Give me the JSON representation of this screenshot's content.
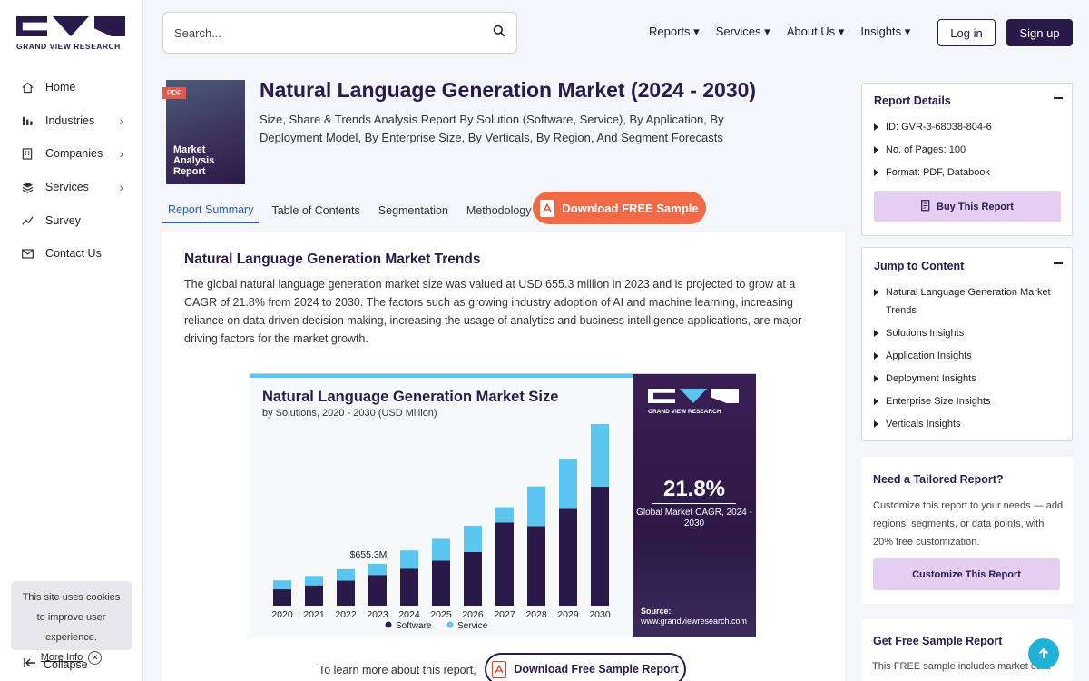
{
  "brand": {
    "name": "GRAND VIEW RESEARCH",
    "colors": {
      "primary": "#2a1a4a",
      "accent": "#5bc6ef",
      "cta": "#f26a45",
      "light_accent": "#e4cff3"
    }
  },
  "sidebar": {
    "items": [
      {
        "label": "Home",
        "icon": "home-icon",
        "has_submenu": false
      },
      {
        "label": "Industries",
        "icon": "bar-chart-icon",
        "has_submenu": true
      },
      {
        "label": "Companies",
        "icon": "building-icon",
        "has_submenu": true
      },
      {
        "label": "Services",
        "icon": "layers-icon",
        "has_submenu": true
      },
      {
        "label": "Survey",
        "icon": "trend-icon",
        "has_submenu": false
      },
      {
        "label": "Contact Us",
        "icon": "mail-icon",
        "has_submenu": false
      }
    ],
    "cookie_text": "This site uses cookies to improve user experience.",
    "cookie_more": "More Info",
    "collapse_label": "Collapse"
  },
  "header": {
    "search_placeholder": "Search...",
    "nav": [
      "Reports",
      "Services",
      "About Us",
      "Insights"
    ],
    "login": "Log in",
    "signup": "Sign up"
  },
  "report": {
    "cover_badge": "PDF",
    "cover_text": "Market Analysis Report",
    "title": "Natural Language Generation Market (2024 - 2030)",
    "subtitle": "Size, Share & Trends Analysis Report By Solution (Software, Service), By Application, By Deployment Model, By Enterprise Size, By Verticals, By Region, And Segment Forecasts",
    "tabs": [
      "Report Summary",
      "Table of Contents",
      "Segmentation",
      "Methodology"
    ],
    "active_tab": "Report Summary",
    "download_btn": "Download FREE Sample"
  },
  "main": {
    "trends_heading": "Natural Language Generation Market Trends",
    "trends_text": "The global natural language generation market size was valued at USD 655.3 million in 2023 and is projected to grow at a CAGR of 21.8% from 2024 to 2030. The factors such as growing industry adoption of AI and machine learning, increasing reliance on data driven decision making, increasing the usage of analytics and business intelligence applications, are major driving factors for the market growth.",
    "learn_more": "To learn more about this report,",
    "download_sample": "Download Free Sample Report"
  },
  "infographic": {
    "title": "Natural Language Generation Market Size",
    "subtitle": "by Solutions, 2020 - 2030 (USD Million)",
    "brand_name": "GRAND VIEW RESEARCH",
    "cagr": "21.8%",
    "cagr_label": "Global Market CAGR, 2024 - 2030",
    "source_label": "Source:",
    "source_url": "www.grandviewresearch.com"
  },
  "chart_data": {
    "type": "bar",
    "stacked": true,
    "title": "Natural Language Generation Market Size",
    "subtitle": "by Solutions, 2020 - 2030 (USD Million)",
    "categories": [
      "2020",
      "2021",
      "2022",
      "2023",
      "2024",
      "2025",
      "2026",
      "2027",
      "2028",
      "2029",
      "2030"
    ],
    "series": [
      {
        "name": "Software",
        "color": "#2a1a4a",
        "values": [
          255,
          317,
          390,
          480,
          578,
          705,
          840,
          1300,
          1245,
          1515,
          1860
        ]
      },
      {
        "name": "Service",
        "color": "#5bc6ef",
        "values": [
          140,
          148,
          180,
          175,
          285,
          340,
          410,
          240,
          620,
          780,
          980
        ]
      }
    ],
    "annotations": [
      {
        "category": "2023",
        "label": "$655.3M"
      }
    ],
    "legend_position": "bottom",
    "grid": false
  },
  "right": {
    "details_heading": "Report Details",
    "details": [
      "ID: GVR-3-68038-804-6",
      "No. of Pages: 100",
      "Format: PDF, Databook"
    ],
    "buy_btn": "Buy This Report",
    "jump_heading": "Jump to Content",
    "jump_items": [
      "Natural Language Generation Market Trends",
      "Solutions Insights",
      "Application Insights",
      "Deployment Insights",
      "Enterprise Size Insights",
      "Verticals Insights"
    ],
    "tailored_heading": "Need a Tailored Report?",
    "tailored_text": "Customize this report to your needs — add regions, segments, or data points, with 20% free customization.",
    "customize_btn": "Customize This Report",
    "sample_heading": "Get Free Sample Report",
    "sample_text": "This FREE sample includes market data"
  }
}
